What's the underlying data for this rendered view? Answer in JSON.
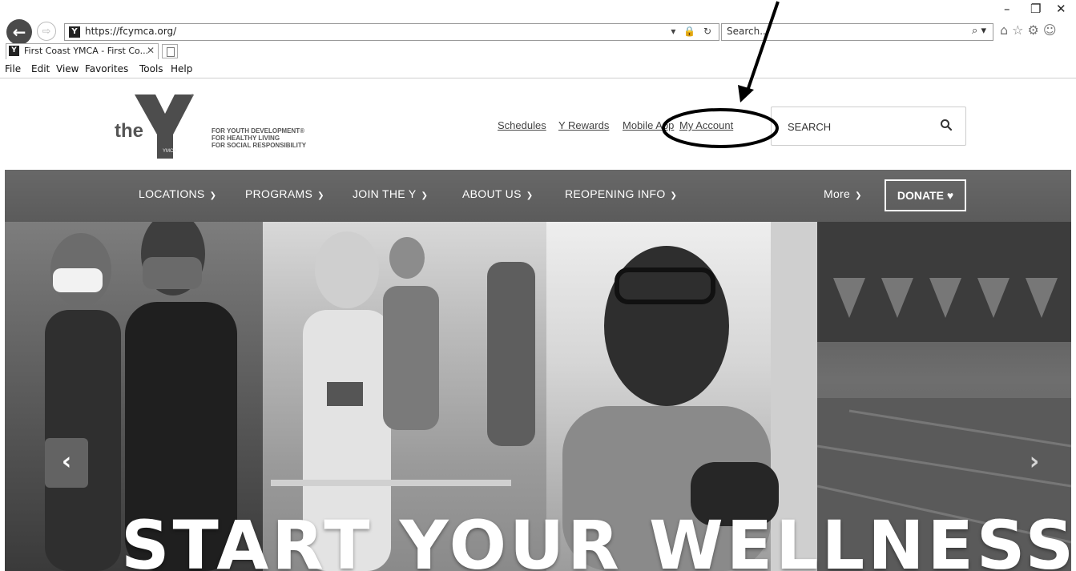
{
  "browser": {
    "url": "https://fcymca.org/",
    "search_placeholder": "Search...",
    "tab_title": "First Coast YMCA - First Co...",
    "favicon_letter": "Y",
    "menu": [
      "File",
      "Edit",
      "View",
      "Favorites",
      "Tools",
      "Help"
    ],
    "window_controls": {
      "minimize": "–",
      "restore": "❐",
      "close": "✕"
    }
  },
  "site": {
    "logo_word": "the",
    "logo_y_text": "YMCA",
    "tagline": [
      "FOR YOUTH DEVELOPMENT®",
      "FOR HEALTHY LIVING",
      "FOR SOCIAL RESPONSIBILITY"
    ],
    "top_links": [
      "Schedules",
      "Y Rewards",
      "Mobile App",
      "My Account"
    ],
    "search_placeholder": "SEARCH",
    "nav": [
      "LOCATIONS",
      "PROGRAMS",
      "JOIN THE Y",
      "ABOUT US",
      "REOPENING INFO"
    ],
    "nav_more": "More",
    "donate_label": "DONATE",
    "hero_headline": "START YOUR WELLNESS"
  },
  "icons": {
    "back": "back-arrow-icon",
    "forward": "forward-arrow-icon",
    "search": "search-icon",
    "home": "home-icon",
    "favorites": "star-icon",
    "settings": "gear-icon",
    "feedback": "smiley-icon",
    "heart": "heart-icon",
    "chevron": "chevron-down-icon"
  },
  "colors": {
    "nav_background": "#626262",
    "link_text": "#444444"
  }
}
